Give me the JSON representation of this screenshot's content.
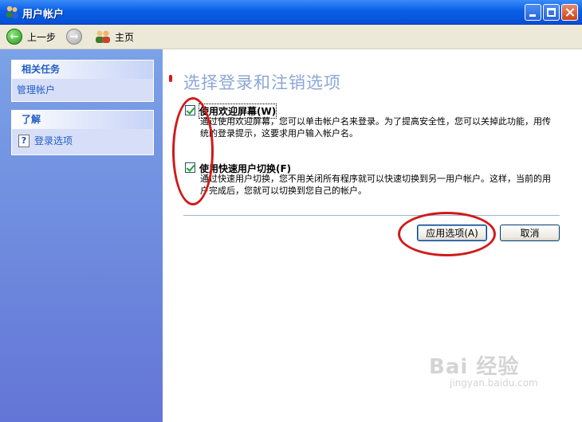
{
  "window": {
    "title": "用户帐户"
  },
  "toolbar": {
    "back_label": "上一步",
    "home_label": "主页"
  },
  "sidebar": {
    "related_tasks": {
      "title": "相关任务",
      "items": [
        {
          "label": "管理帐户"
        }
      ]
    },
    "learn_about": {
      "title": "了解",
      "items": [
        {
          "label": "登录选项"
        }
      ]
    }
  },
  "main": {
    "heading": "选择登录和注销选项",
    "options": [
      {
        "label": "使用欢迎屏幕(W)",
        "checked": true,
        "description": "通过使用欢迎屏幕，您可以单击帐户名来登录。为了提高安全性，您可以关掉此功能，用传统的登录提示，这要求用户输入帐户名。"
      },
      {
        "label": "使用快速用户切换(F)",
        "checked": true,
        "description": "通过快速用户切换，您不用关闭所有程序就可以快速切换到另一用户帐户。这样，当前的用户完成后，您就可以切换到您自己的帐户。"
      }
    ],
    "apply_button": "应用选项(A)",
    "cancel_button": "取消"
  },
  "watermark": {
    "brand": "Bai 经验",
    "url": "jingyan.baidu.com"
  },
  "colors": {
    "titlebar": "#0a5fe6",
    "sidebar": "#6375d6",
    "heading": "#8ba7d6",
    "annotation": "#d11a1a"
  }
}
